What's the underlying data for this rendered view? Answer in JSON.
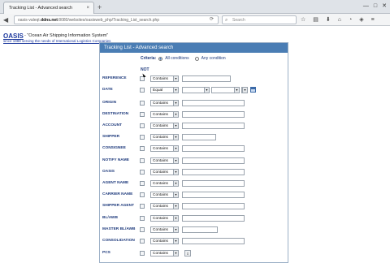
{
  "browser": {
    "tab_title": "Tracking List - Advanced search",
    "tab_close": "×",
    "new_tab": "+",
    "window_buttons": [
      "—",
      "□",
      "✕"
    ],
    "url_prefix": "oasis-valeqt.",
    "url_domain": "ddns.net",
    "url_suffix": ":8080/websites/oasisweb_php/Tracking_List_search.php",
    "search_placeholder": "Search",
    "icons": [
      "star-icon",
      "reader-icon",
      "download-icon",
      "home-icon",
      "pocket-icon",
      "shield-icon",
      "menu-icon"
    ]
  },
  "header": {
    "logo": "OASIS",
    "tagline": "- \"Ocean Air Shipping Information System\"",
    "since": "since 1988 serving the needs of International Logistics Companies"
  },
  "panel": {
    "title": "Tracking List - Advanced search",
    "criteria_label": "Criteria:",
    "option_all": "All conditions",
    "option_any": "Any condition",
    "not_header": "NOT"
  },
  "fields": [
    {
      "label": "REFERENCE",
      "op": "Contains"
    },
    {
      "label": "DATE",
      "op": "Equal"
    },
    {
      "label": "ORIGIN",
      "op": "Contains"
    },
    {
      "label": "DESTINATION",
      "op": "Contains"
    },
    {
      "label": "ACCOUNT",
      "op": "Contains"
    },
    {
      "label": "SHIPPER",
      "op": "Contains"
    },
    {
      "label": "CONSIGNEE",
      "op": "Contains"
    },
    {
      "label": "NOTIFY NAME",
      "op": "Contains"
    },
    {
      "label": "OASIS",
      "op": "Contains"
    },
    {
      "label": "AGENT NAME",
      "op": "Contains"
    },
    {
      "label": "CARRIER NAME",
      "op": "Contains"
    },
    {
      "label": "SHIPPER AGENT",
      "op": "Contains"
    },
    {
      "label": "BL/AWB",
      "op": "Contains"
    },
    {
      "label": "MASTER BL/AWB",
      "op": "Contains"
    },
    {
      "label": "CONSOLIDATION",
      "op": "Contains"
    },
    {
      "label": "PCS",
      "op": "Contains"
    }
  ]
}
